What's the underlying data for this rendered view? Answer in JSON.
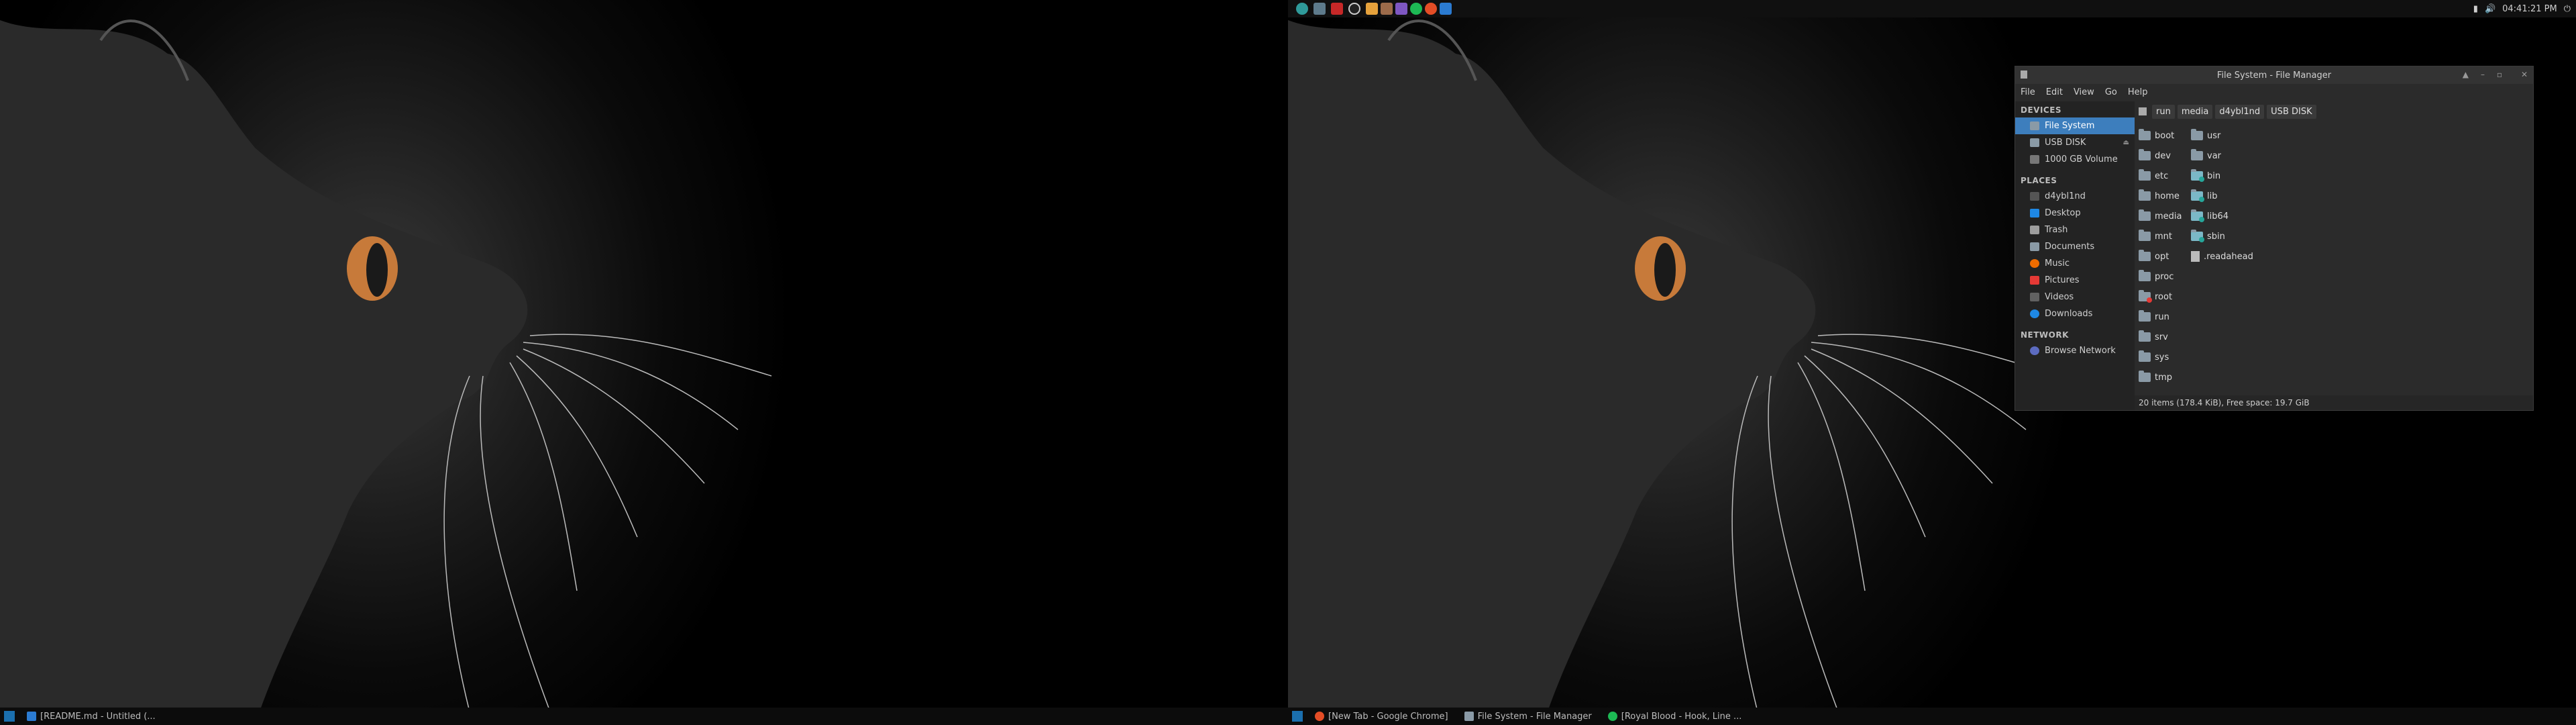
{
  "topbar": {
    "clock": "04:41:21 PM"
  },
  "taskbar_left": {
    "tasks": [
      {
        "label": "[README.md - Untitled (..."
      }
    ]
  },
  "taskbar_right": {
    "tasks": [
      {
        "label": "[New Tab - Google Chrome]"
      },
      {
        "label": "File System - File Manager"
      },
      {
        "label": "[Royal Blood - Hook, Line ..."
      }
    ]
  },
  "file_manager": {
    "title": "File System - File Manager",
    "menu": [
      "File",
      "Edit",
      "View",
      "Go",
      "Help"
    ],
    "sidebar": {
      "devices_header": "DEVICES",
      "devices": [
        "File System",
        "USB DISK",
        "1000 GB Volume"
      ],
      "places_header": "PLACES",
      "places": [
        "d4ybl1nd",
        "Desktop",
        "Trash",
        "Documents",
        "Music",
        "Pictures",
        "Videos",
        "Downloads"
      ],
      "network_header": "NETWORK",
      "network": [
        "Browse Network"
      ]
    },
    "breadcrumbs": [
      "run",
      "media",
      "d4ybl1nd",
      "USB DISK"
    ],
    "files_col1": [
      "boot",
      "dev",
      "etc",
      "home",
      "media",
      "mnt",
      "opt",
      "proc",
      "root",
      "run",
      "srv",
      "sys",
      "tmp"
    ],
    "files_col2": [
      "usr",
      "var",
      "bin",
      "lib",
      "lib64",
      "sbin",
      ".readahead"
    ],
    "status": "20 items (178.4 KiB), Free space: 19.7 GiB"
  },
  "colors": {
    "accent": "#3d7ebd",
    "panel": "#101010",
    "window_bg": "#2b2b2b"
  }
}
